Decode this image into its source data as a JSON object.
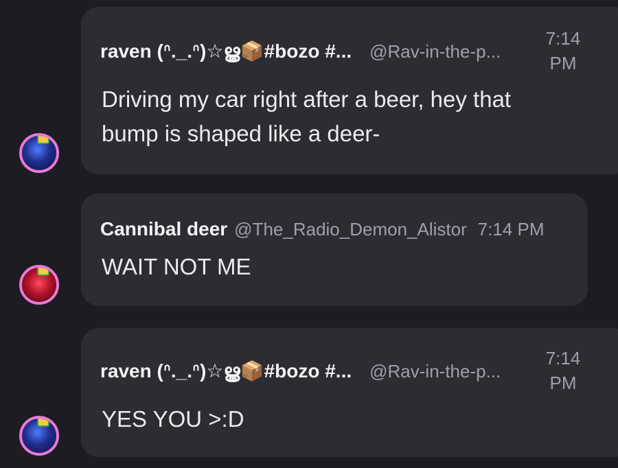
{
  "messages": [
    {
      "display_name": "raven (ᐢ._.ᐢ)☆ൠ📦#bozo #...",
      "handle": "@Rav-in-the-p...",
      "time": "7:14",
      "time_period": "PM",
      "text_line1": "Driving my car right after a beer, hey that",
      "text_line2": "bump is shaped like a deer-",
      "avatar_icon": "blue-character-avatar-icon"
    },
    {
      "display_name": "Cannibal deer",
      "handle": "@The_Radio_Demon_Alistor",
      "time_full": "7:14 PM",
      "text": "WAIT NOT ME",
      "avatar_icon": "red-character-avatar-icon"
    },
    {
      "display_name": "raven (ᐢ._.ᐢ)☆ൠ📦#bozo #...",
      "handle": "@Rav-in-the-p...",
      "time": "7:14",
      "time_period": "PM",
      "text": "YES YOU >:D",
      "avatar_icon": "blue-character-avatar-icon"
    }
  ],
  "colors": {
    "background": "#1d1c22",
    "bubble": "#2d2c33",
    "avatar_ring": "#e879d6",
    "name_text": "#f2f2f4",
    "meta_text": "#a19fa8"
  }
}
